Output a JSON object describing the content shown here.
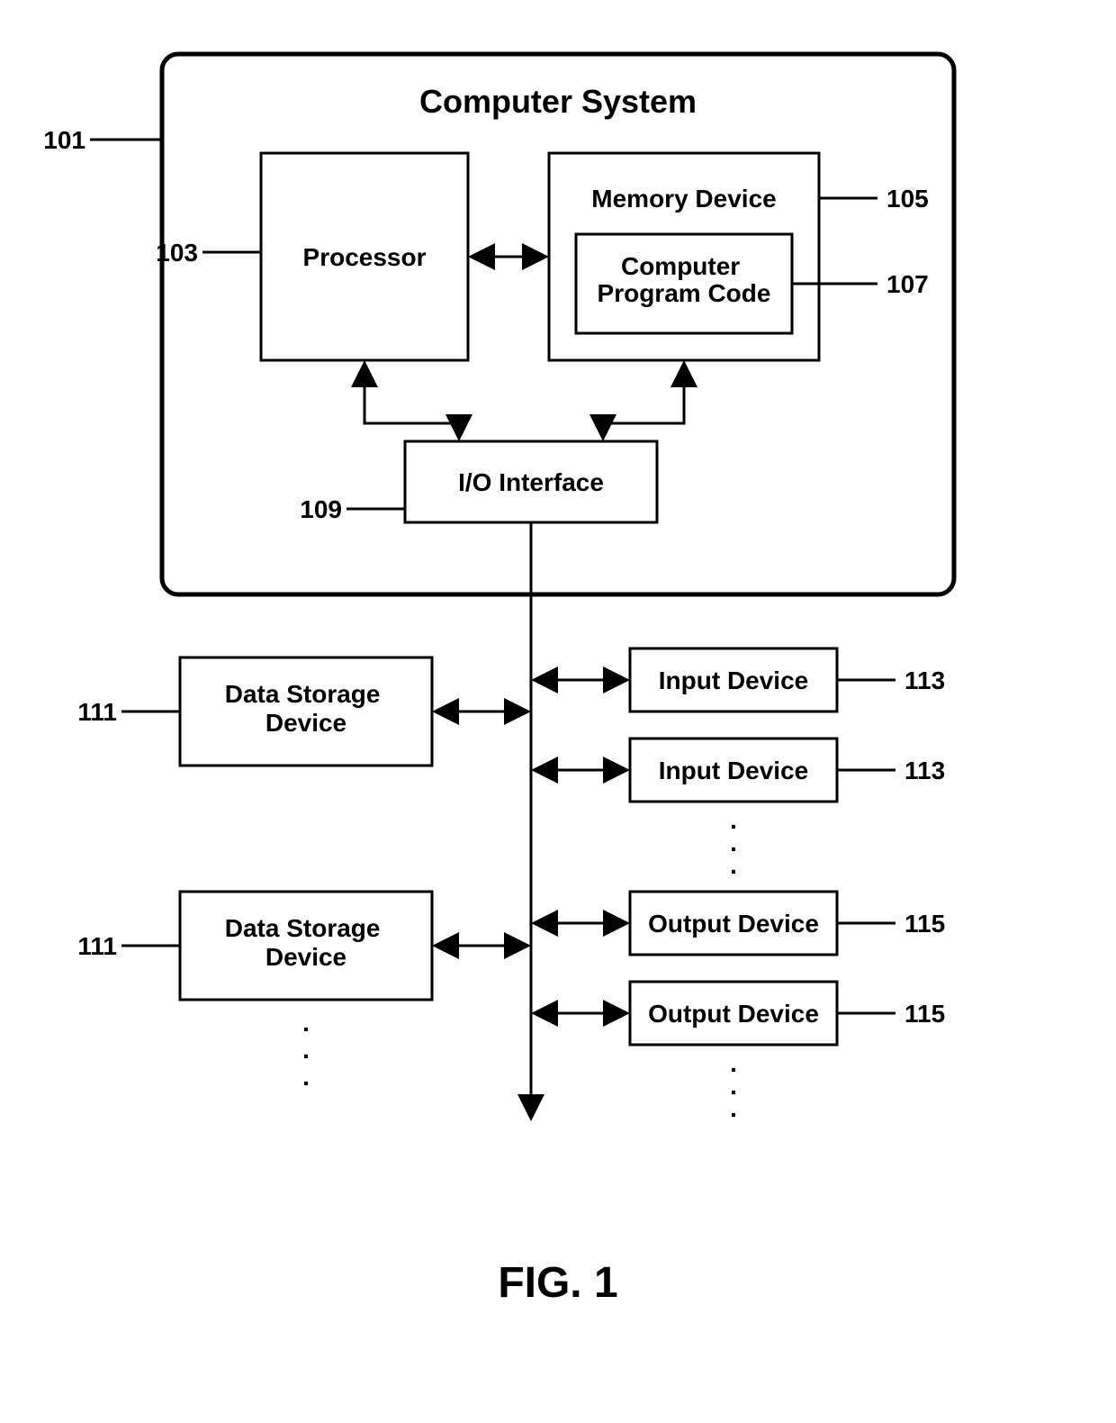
{
  "figure_label": "FIG. 1",
  "title": "Computer System",
  "boxes": {
    "processor": "Processor",
    "memory": "Memory Device",
    "program": "Computer\nProgram Code",
    "io": "I/O Interface",
    "data_storage": "Data Storage\nDevice",
    "input": "Input Device",
    "output": "Output Device"
  },
  "refs": {
    "system": "101",
    "processor": "103",
    "memory": "105",
    "program": "107",
    "io": "109",
    "data_storage": "111",
    "input": "113",
    "output": "115"
  }
}
